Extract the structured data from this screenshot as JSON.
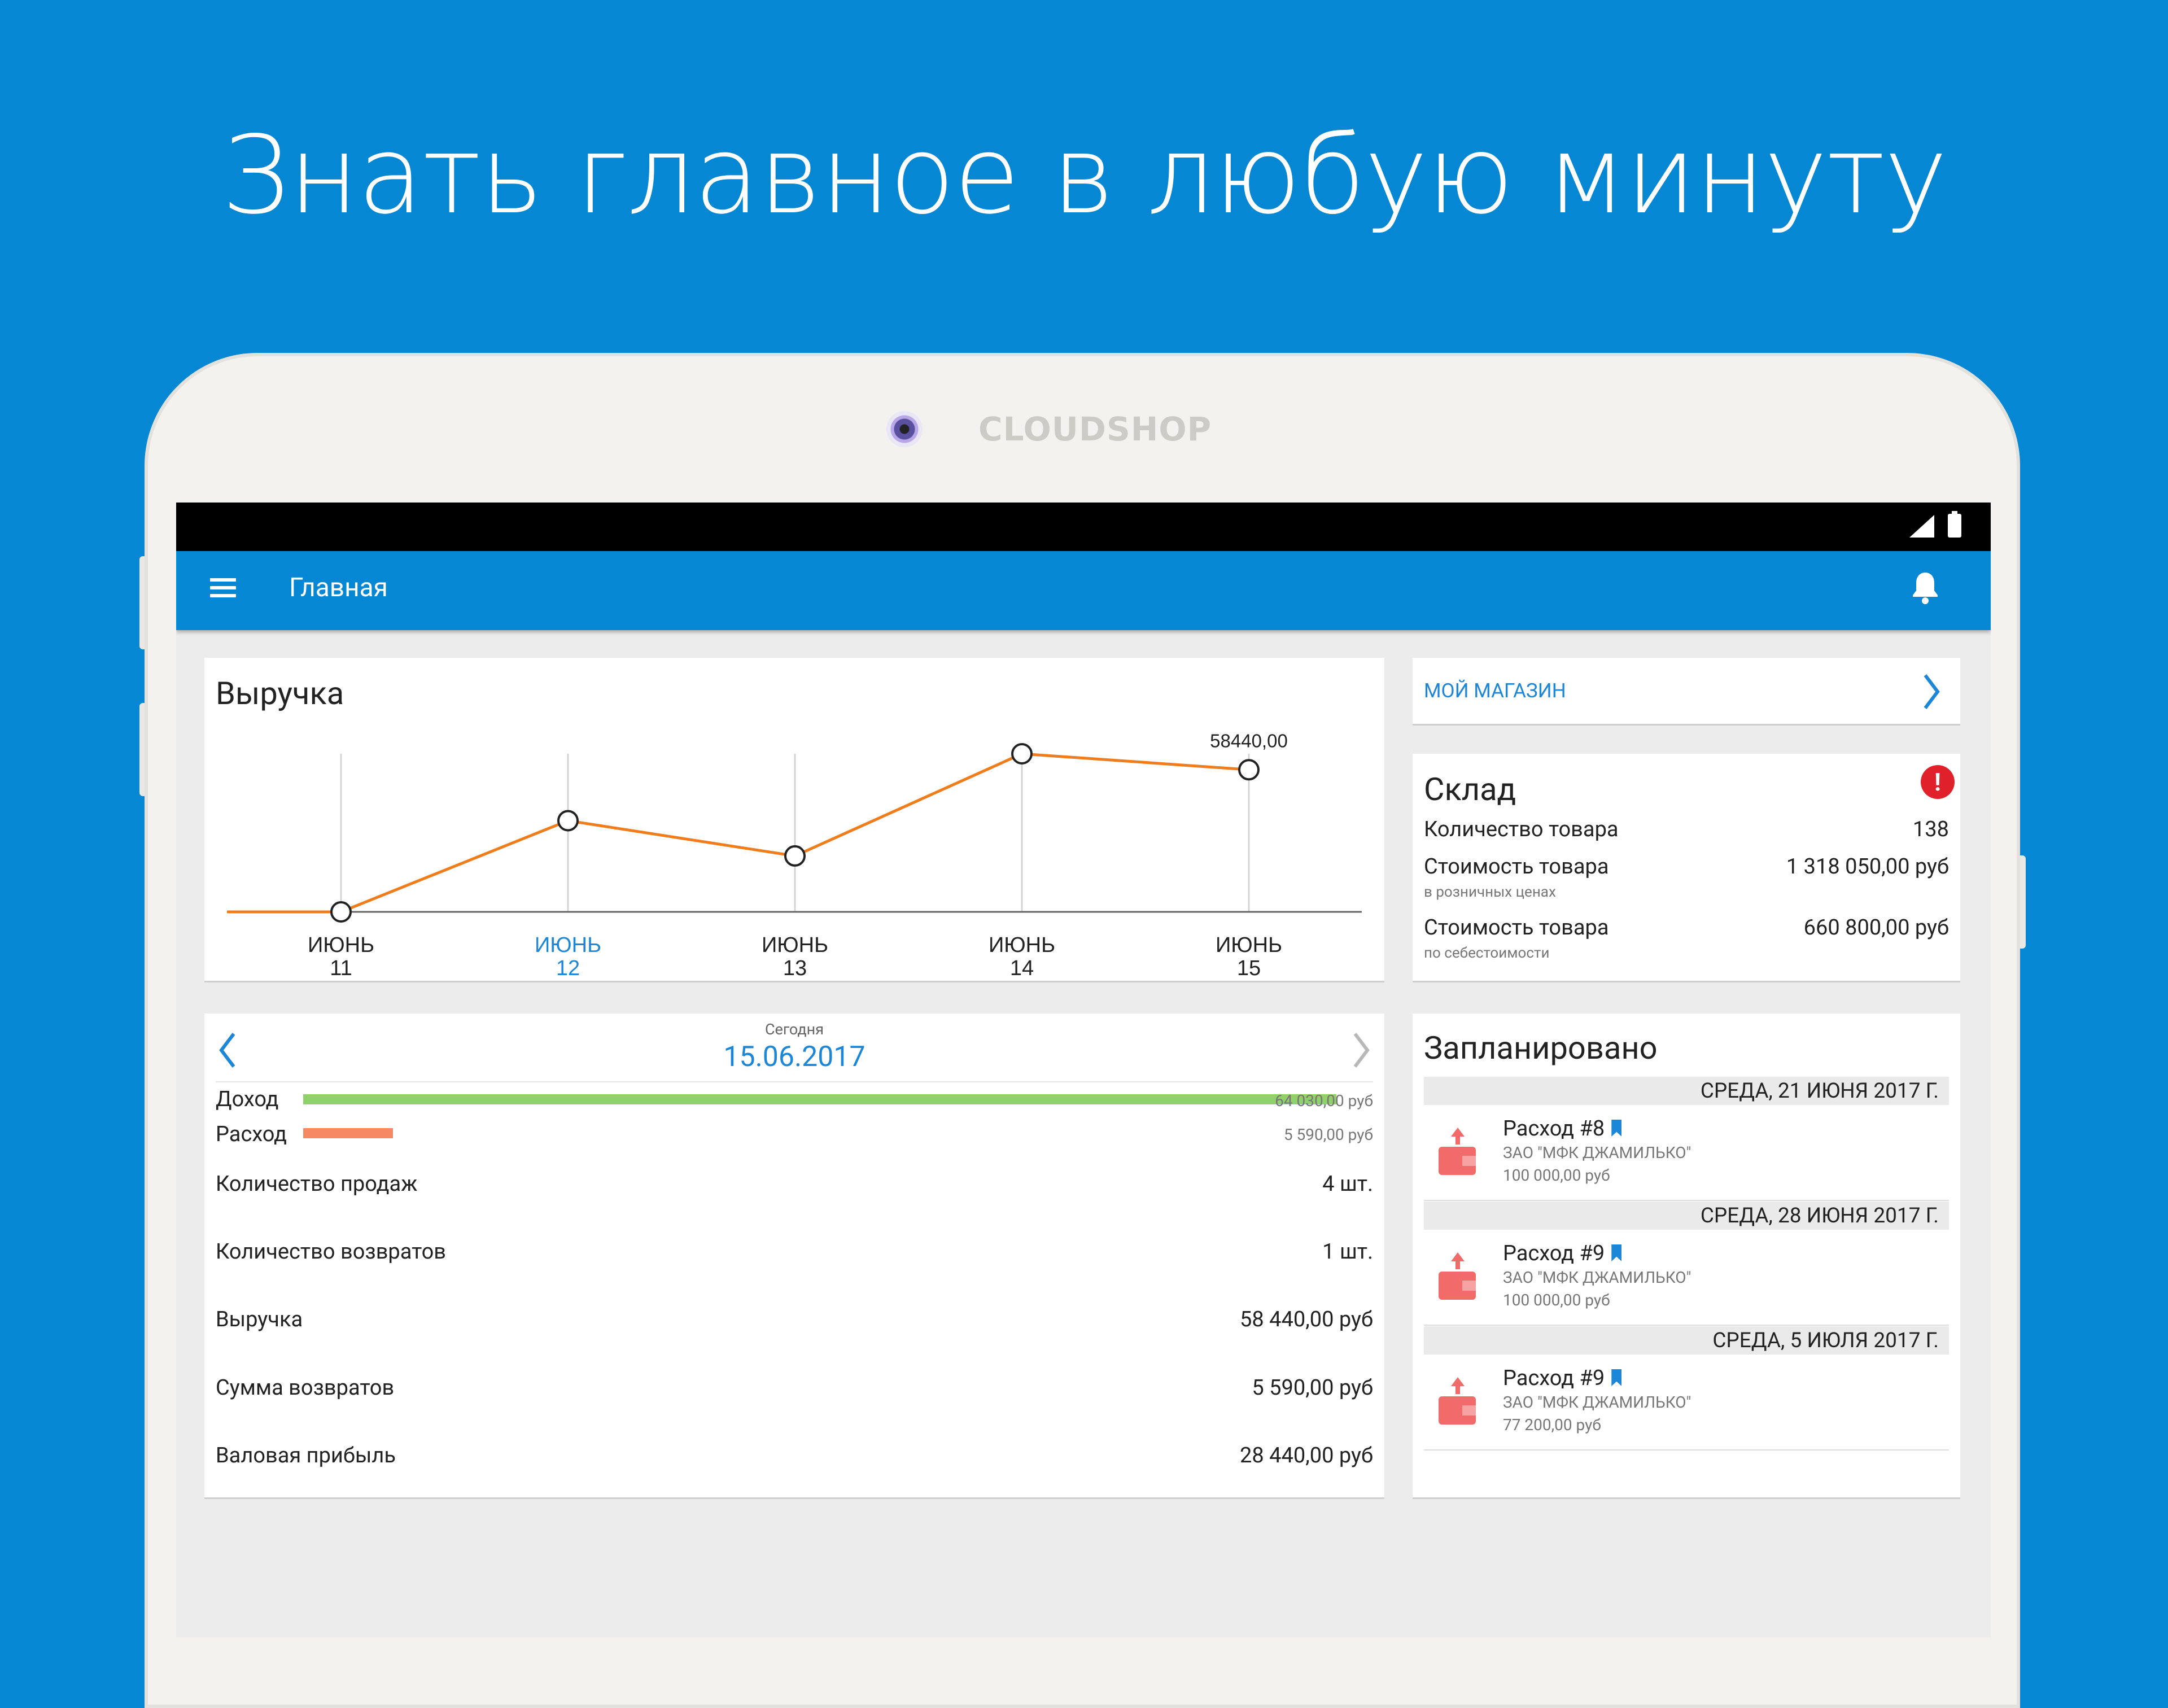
{
  "headline": "Знать главное в любую минуту",
  "brand": "CLOUDSHOP",
  "appbar": {
    "title": "Главная"
  },
  "revenue": {
    "title": "Выручка"
  },
  "chart_data": {
    "type": "line",
    "title": "Выручка",
    "categories": [
      {
        "month": "ИЮНЬ",
        "day": "11"
      },
      {
        "month": "ИЮНЬ",
        "day": "12"
      },
      {
        "month": "ИЮНЬ",
        "day": "13"
      },
      {
        "month": "ИЮНЬ",
        "day": "14"
      },
      {
        "month": "ИЮНЬ",
        "day": "15"
      }
    ],
    "values": [
      0,
      37500,
      23000,
      65000,
      58440
    ],
    "selected_index": 1,
    "point_label": "58440,00",
    "line_color": "#f07c1a",
    "selected_color": "#1c87d8"
  },
  "day": {
    "today_label": "Сегодня",
    "date": "15.06.2017",
    "income_label": "Доход",
    "income_value": "64 030,00 руб",
    "income_fraction": 1.0,
    "expense_label": "Расход",
    "expense_value": "5 590,00 руб",
    "expense_fraction": 0.087,
    "rows": [
      {
        "label": "Количество продаж",
        "value": "4 шт."
      },
      {
        "label": "Количество возвратов",
        "value": "1 шт."
      },
      {
        "label": "Выручка",
        "value": "58 440,00 руб"
      },
      {
        "label": "Сумма возвратов",
        "value": "5 590,00 руб"
      },
      {
        "label": "Валовая прибыль",
        "value": "28 440,00 руб"
      }
    ]
  },
  "shop": {
    "label": "МОЙ МАГАЗИН"
  },
  "stock": {
    "title": "Склад",
    "qty_label": "Количество товара",
    "qty_value": "138",
    "retail_label": "Стоимость товара",
    "retail_sub": "в розничных ценах",
    "retail_value": "1 318 050,00 руб",
    "cost_label": "Стоимость товара",
    "cost_sub": "по себестоимости",
    "cost_value": "660 800,00 руб"
  },
  "plan": {
    "title": "Запланировано",
    "groups": [
      {
        "date": "СРЕДА, 21 ИЮНЯ 2017 Г.",
        "name": "Расход #8",
        "org": "ЗАО \"МФК ДЖАМИЛЬКО\"",
        "amount": "100 000,00 руб"
      },
      {
        "date": "СРЕДА, 28 ИЮНЯ 2017 Г.",
        "name": "Расход #9",
        "org": "ЗАО \"МФК ДЖАМИЛЬКО\"",
        "amount": "100 000,00 руб"
      },
      {
        "date": "СРЕДА, 5 ИЮЛЯ 2017 Г.",
        "name": "Расход #9",
        "org": "ЗАО \"МФК ДЖАМИЛЬКО\"",
        "amount": "77 200,00 руб"
      }
    ]
  },
  "colors": {
    "background": "#0587d4",
    "income_bar": "#8fd16d",
    "expense_bar": "#f58a62",
    "alert": "#e0202a",
    "wallet": "#f16b6b"
  }
}
